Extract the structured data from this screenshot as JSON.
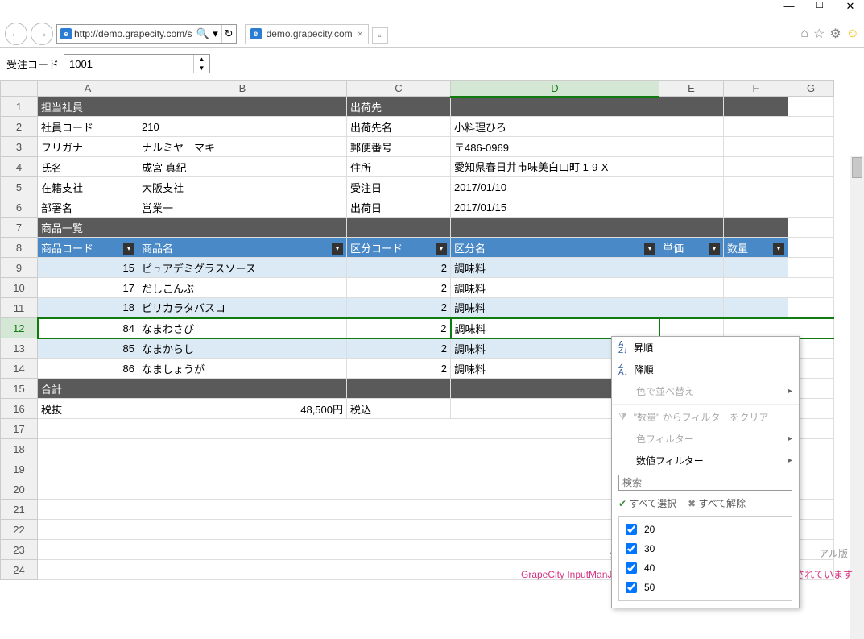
{
  "window": {
    "url": "http://demo.grapecity.com/s",
    "tab_title": "demo.grapecity.com",
    "search_placeholder": ""
  },
  "orderbar": {
    "label": "受注コード",
    "value": "1001"
  },
  "cols": [
    "A",
    "B",
    "C",
    "D",
    "E",
    "F",
    "G"
  ],
  "rows": {
    "r1": {
      "a": "担当社員",
      "c": "出荷先"
    },
    "r2": {
      "a": "社員コード",
      "b": "210",
      "c": "出荷先名",
      "d": "小料理ひろ"
    },
    "r3": {
      "a": "フリガナ",
      "b": "ナルミヤ　マキ",
      "c": "郵便番号",
      "d": "〒486-0969"
    },
    "r4": {
      "a": "氏名",
      "b": "成宮 真紀",
      "c": "住所",
      "d": "愛知県春日井市味美白山町 1-9-X"
    },
    "r5": {
      "a": "在籍支社",
      "b": "大阪支社",
      "c": "受注日",
      "d": "2017/01/10"
    },
    "r6": {
      "a": "部署名",
      "b": "営業一",
      "c": "出荷日",
      "d": "2017/01/15"
    },
    "r7": {
      "a": "商品一覧"
    },
    "r8": {
      "a": "商品コード",
      "b": "商品名",
      "c": "区分コード",
      "d": "区分名",
      "e": "単価",
      "f": "数量"
    },
    "r9": {
      "a": "15",
      "b": "ピュアデミグラスソース",
      "c": "2",
      "d": "調味料"
    },
    "r10": {
      "a": "17",
      "b": "だしこんぶ",
      "c": "2",
      "d": "調味料"
    },
    "r11": {
      "a": "18",
      "b": "ピリカラタバスコ",
      "c": "2",
      "d": "調味料"
    },
    "r12": {
      "a": "84",
      "b": "なまわさび",
      "c": "2",
      "d": "調味料"
    },
    "r13": {
      "a": "85",
      "b": "なまからし",
      "c": "2",
      "d": "調味料"
    },
    "r14": {
      "a": "86",
      "b": "なましょうが",
      "c": "2",
      "d": "調味料"
    },
    "r15": {
      "a": "合計"
    },
    "r16": {
      "a": "税抜",
      "b": "48,500円",
      "c": "税込"
    }
  },
  "filter": {
    "asc": "昇順",
    "desc": "降順",
    "colorSort": "色で並べ替え",
    "clearFilter": "\"数量\" からフィルターをクリア",
    "colorFilter": "色フィルター",
    "numFilter": "数値フィルター",
    "searchPlaceholder": "検索",
    "selectAll": "すべて選択",
    "clearAll": "すべて解除",
    "options": [
      "20",
      "30",
      "40",
      "50"
    ]
  },
  "trial": {
    "gray_left": "グレ",
    "gray_right": "アル版",
    "link": "GrapeCity InputManJSトライアル版 本バージョンの配布は禁止されています"
  }
}
